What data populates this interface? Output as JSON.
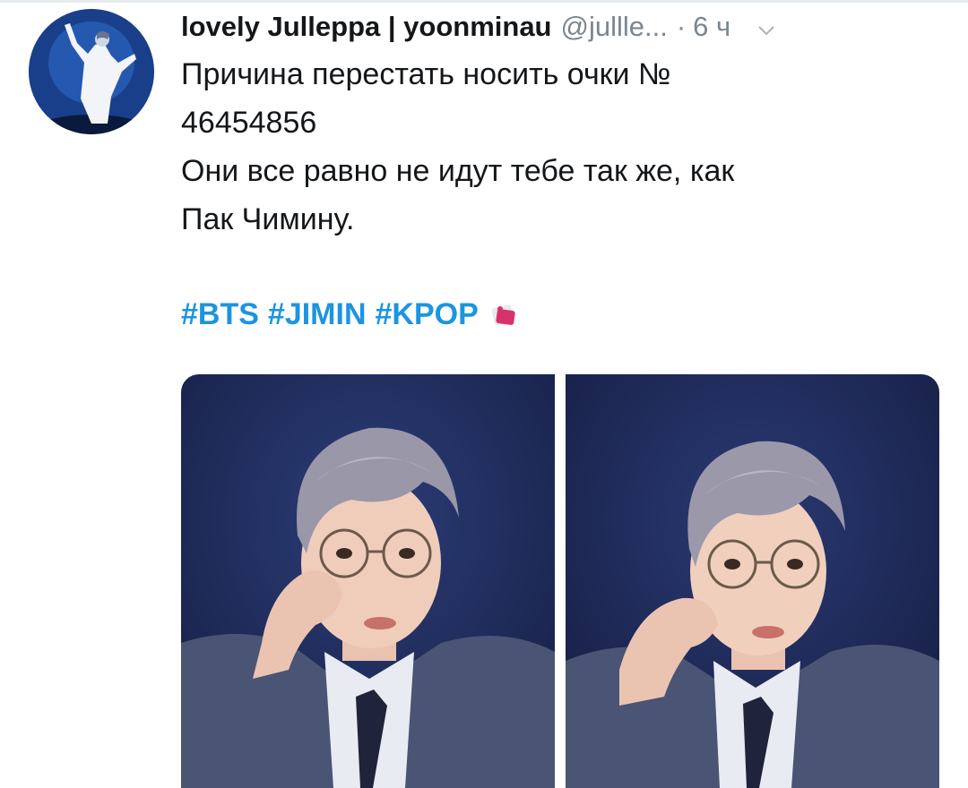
{
  "tweet": {
    "display_name": "lovely Julleppa | yoonminau",
    "handle": "@julllе...",
    "time_sep": "·",
    "time": "6 ч",
    "text_lines": [
      "Причина перестать носить очки №",
      "46454856",
      "Они все равно не идут тебе так же, как",
      "Пак Чимину."
    ],
    "hashtags": [
      "#BTS",
      "#JIMIN",
      "#KPOP"
    ],
    "badge_icon": "kpop-sticker-icon",
    "menu_icon": "chevron-down-icon"
  },
  "colors": {
    "hashtag": "#1b95e0",
    "muted": "#7a8690",
    "text": "#14171a",
    "photo_bg": "#1c2a5a"
  }
}
